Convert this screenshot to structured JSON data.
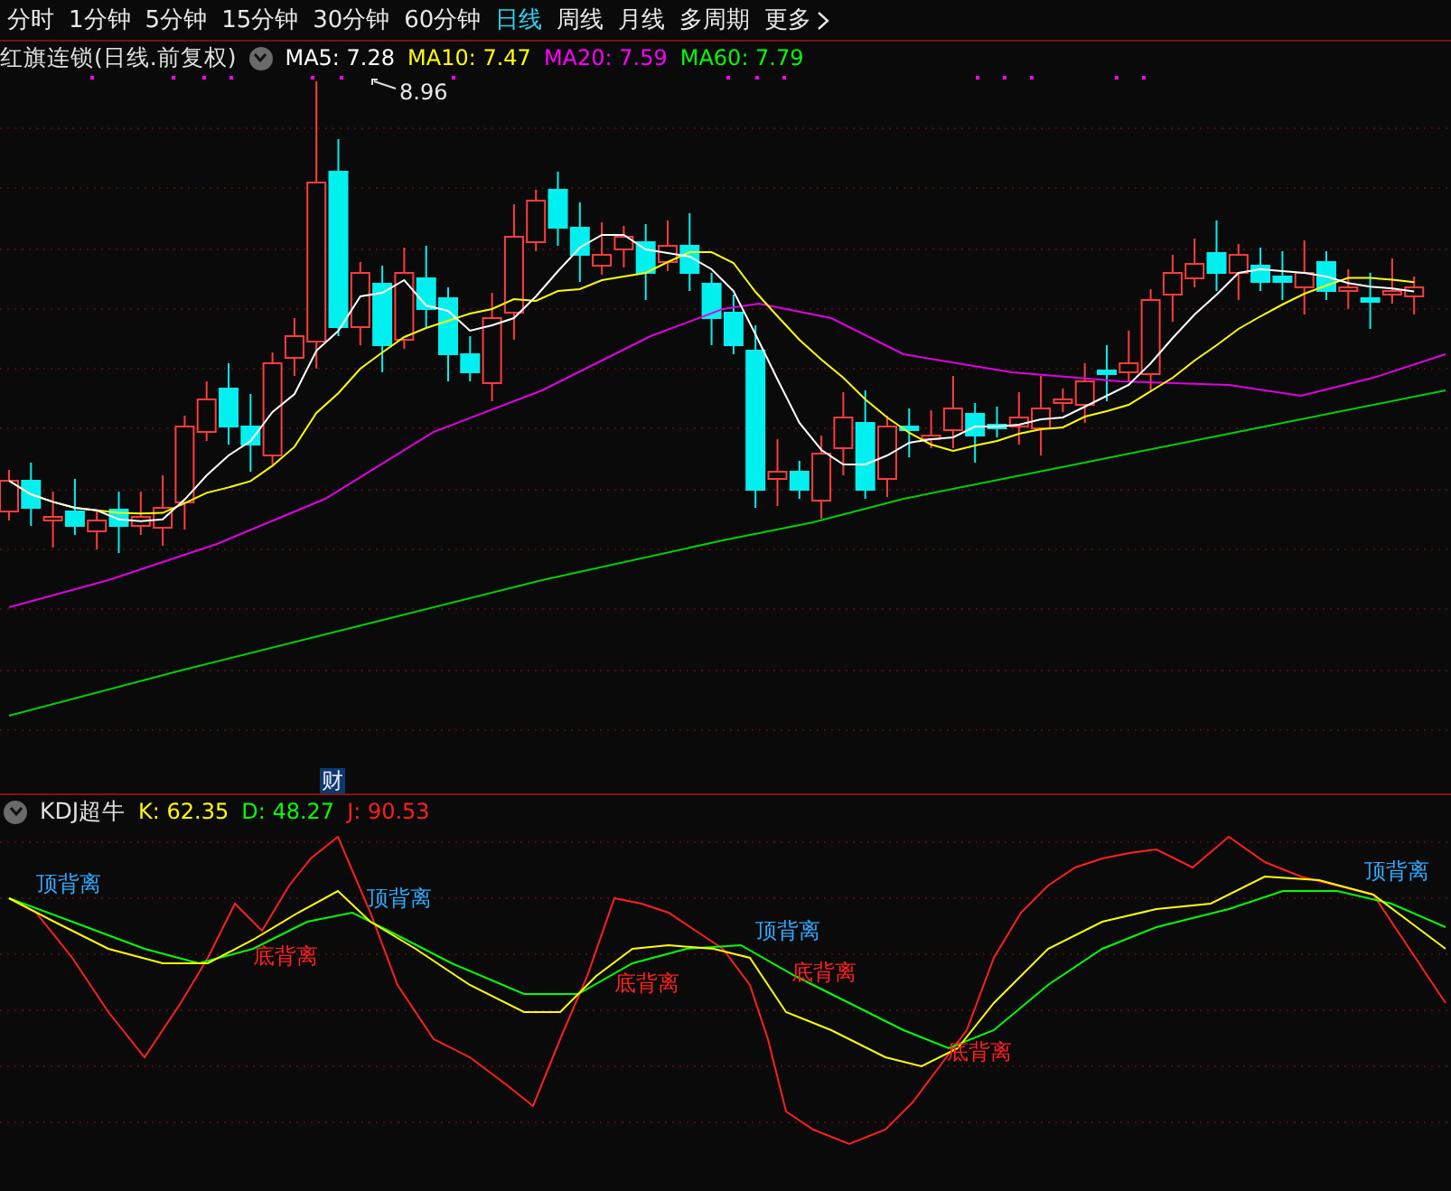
{
  "periods": [
    {
      "label": "分时",
      "selected": false
    },
    {
      "label": "1分钟",
      "selected": false
    },
    {
      "label": "5分钟",
      "selected": false
    },
    {
      "label": "15分钟",
      "selected": false
    },
    {
      "label": "30分钟",
      "selected": false
    },
    {
      "label": "60分钟",
      "selected": false
    },
    {
      "label": "日线",
      "selected": true
    },
    {
      "label": "周线",
      "selected": false
    },
    {
      "label": "月线",
      "selected": false
    },
    {
      "label": "多周期",
      "selected": false
    },
    {
      "label": "更多",
      "selected": false
    }
  ],
  "main_panel": {
    "title": "红旗连锁(日线.前复权)",
    "indicators": [
      {
        "label": "MA5: 7.28",
        "color": "#ffffff"
      },
      {
        "label": "MA10: 7.47",
        "color": "#ffff00"
      },
      {
        "label": "MA20: 7.59",
        "color": "#ff00ff"
      },
      {
        "label": "MA60: 7.79",
        "color": "#00ff00"
      }
    ],
    "peak_label": "8.96",
    "event_marker": "财"
  },
  "kdj_panel": {
    "title": "KDJ超牛",
    "readings": [
      {
        "label": "K: 62.35",
        "color": "#ffff00"
      },
      {
        "label": "D: 48.27",
        "color": "#00ff00"
      },
      {
        "label": "J: 90.53",
        "color": "#ff2020"
      }
    ],
    "annotations": [
      {
        "text": "顶背离",
        "kind": "top"
      },
      {
        "text": "底背离",
        "kind": "bottom"
      },
      {
        "text": "顶背离",
        "kind": "top"
      },
      {
        "text": "底背离",
        "kind": "bottom"
      },
      {
        "text": "顶背离",
        "kind": "top"
      },
      {
        "text": "底背离",
        "kind": "bottom"
      },
      {
        "text": "底背离",
        "kind": "bottom"
      },
      {
        "text": "顶背离",
        "kind": "top"
      }
    ]
  }
}
